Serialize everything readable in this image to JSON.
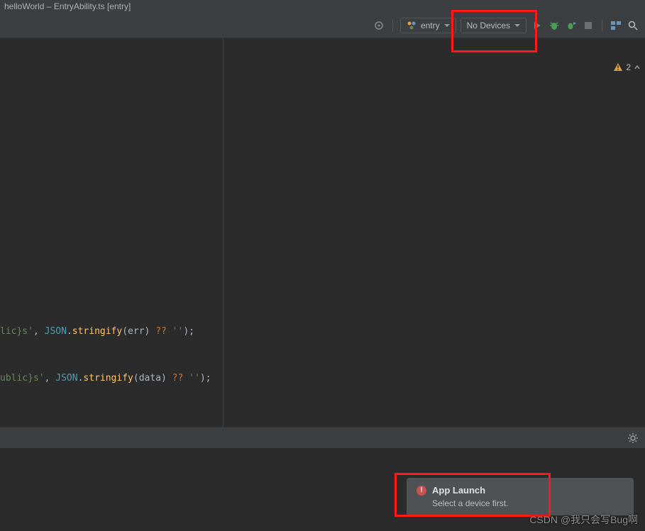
{
  "window": {
    "title": "helloWorld – EntryAbility.ts [entry]"
  },
  "toolbar": {
    "module_dropdown": "entry",
    "device_dropdown": "No Devices"
  },
  "editor": {
    "warning_count": "2",
    "line1": {
      "str": "lic}s'",
      "json": "JSON",
      "fn": "stringify",
      "param": "err",
      "nullish": "??",
      "empty": "''"
    },
    "line2": {
      "str": "ublic}s'",
      "json": "JSON",
      "fn": "stringify",
      "param": "data",
      "nullish": "??",
      "empty": "''"
    }
  },
  "notification": {
    "title": "App Launch",
    "body": "Select a device first."
  },
  "watermark": "CSDN @我只会写Bug啊"
}
